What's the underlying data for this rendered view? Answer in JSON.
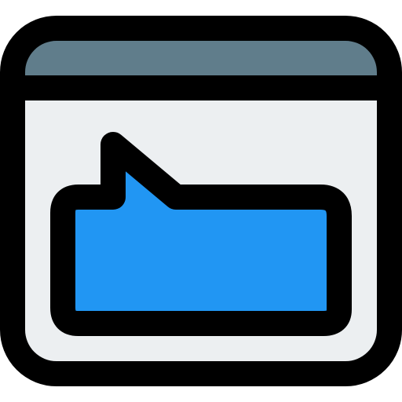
{
  "icon": {
    "name": "browser-window-speech-bubble-icon",
    "colors": {
      "outline": "#000000",
      "title_bar": "#607D8B",
      "window_body": "#ECEFF1",
      "bubble": "#2196F3"
    }
  }
}
